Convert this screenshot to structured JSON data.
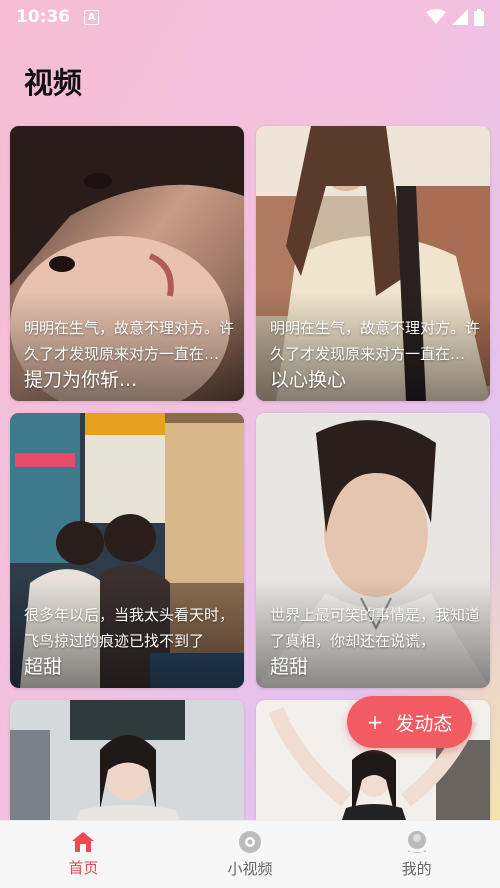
{
  "status_bar": {
    "time": "10:36",
    "notification_letter": "A"
  },
  "page_title": "视频",
  "cards": [
    {
      "desc": "明明在生气，故意不理对方。许久了才发现原来对方一直在等自己开口",
      "title": "提刀为你斩..."
    },
    {
      "desc": "明明在生气，故意不理对方。许久了才发现原来对方一直在等自己开口",
      "title": "以心换心"
    },
    {
      "desc": "很多年以后，当我太头看天时，飞鸟掠过的痕迹已找不到了",
      "title": "超甜"
    },
    {
      "desc": "世界上最可笑的事情是，我知道了真相，你却还在说谎，",
      "title": "超甜"
    },
    {
      "desc": "",
      "title": ""
    },
    {
      "desc": "",
      "title": ""
    }
  ],
  "fab": {
    "plus": "+",
    "label": "发动态"
  },
  "tabs": [
    {
      "label": "首页",
      "icon": "home-icon",
      "active": true
    },
    {
      "label": "小视频",
      "icon": "video-icon",
      "active": false
    },
    {
      "label": "我的",
      "icon": "profile-icon",
      "active": false
    }
  ],
  "colors": {
    "accent": "#f35b63",
    "active_tab": "#f0494f"
  }
}
